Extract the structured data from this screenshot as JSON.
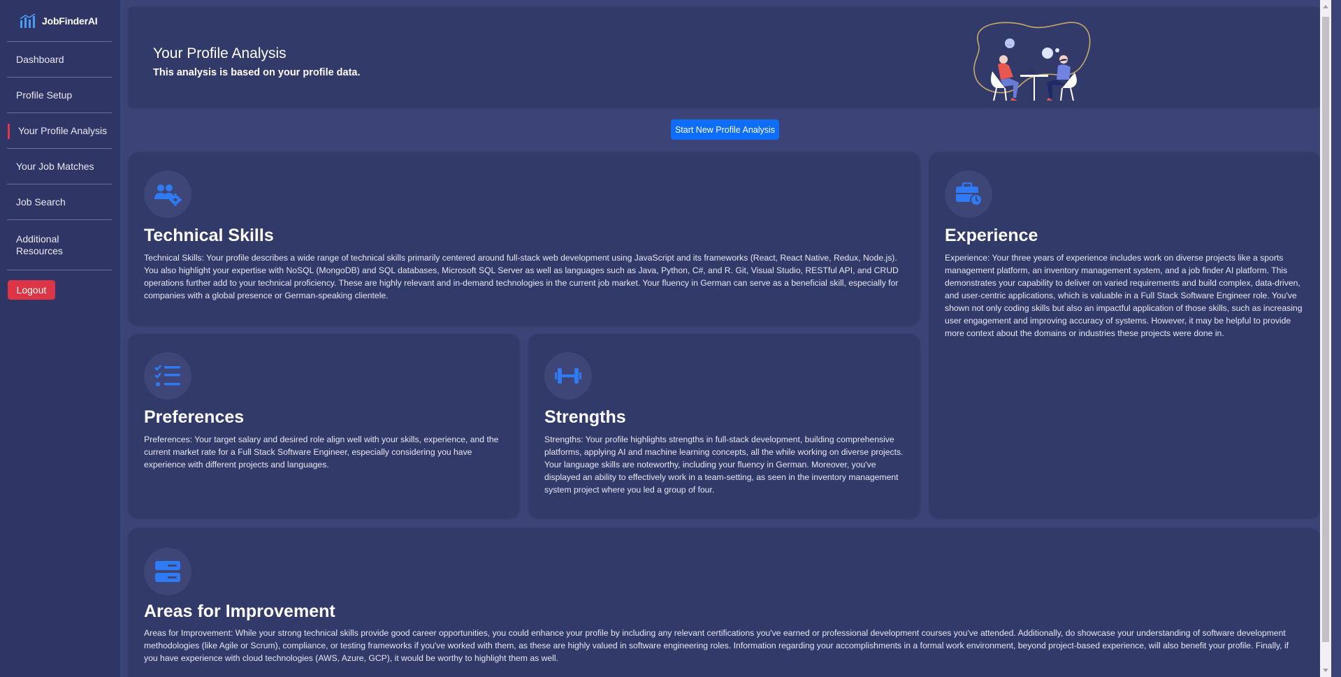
{
  "app": {
    "name": "JobFinderAI"
  },
  "sidebar": {
    "items": [
      {
        "label": "Dashboard",
        "active": false
      },
      {
        "label": "Profile Setup",
        "active": false
      },
      {
        "label": "Your Profile Analysis",
        "active": true
      },
      {
        "label": "Your Job Matches",
        "active": false
      },
      {
        "label": "Job Search",
        "active": false
      },
      {
        "label": "Additional Resources",
        "active": false
      }
    ],
    "logout_label": "Logout"
  },
  "header": {
    "title": "Your Profile Analysis",
    "subtitle": "This analysis is based on your profile data."
  },
  "actions": {
    "start_label": "Start New Profile Analysis"
  },
  "cards": {
    "technical": {
      "title": "Technical Skills",
      "icon": "users-gear-icon",
      "text": "Technical Skills: Your profile describes a wide range of technical skills primarily centered around full-stack web development using JavaScript and its frameworks (React, React Native, Redux, Node.js). You also highlight your expertise with NoSQL (MongoDB) and SQL databases, Microsoft SQL Server as well as languages such as Java, Python, C#, and R. Git, Visual Studio, RESTful API, and CRUD operations further add to your technical proficiency. These are highly relevant and in-demand technologies in the current job market. Your fluency in German can serve as a beneficial skill, especially for companies with a global presence or German-speaking clientele."
    },
    "experience": {
      "title": "Experience",
      "icon": "briefcase-clock-icon",
      "text": "Experience: Your three years of experience includes work on diverse projects like a sports management platform, an inventory management system, and a job finder AI platform. This demonstrates your capability to deliver on varied requirements and build complex, data-driven, and user-centric applications, which is valuable in a Full Stack Software Engineer role. You've shown not only coding skills but also an impactful application of those skills, such as increasing user engagement and improving accuracy of systems. However, it may be helpful to provide more context about the domains or industries these projects were done in."
    },
    "preferences": {
      "title": "Preferences",
      "icon": "list-check-icon",
      "text": "Preferences: Your target salary and desired role align well with your skills, experience, and the current market rate for a Full Stack Software Engineer, especially considering you have experience with different projects and languages."
    },
    "strengths": {
      "title": "Strengths",
      "icon": "dumbbell-icon",
      "text": "Strengths: Your profile highlights strengths in full-stack development, building comprehensive platforms, applying AI and machine learning concepts, all the while working on diverse projects. Your language skills are noteworthy, including your fluency in German. Moreover, you've displayed an ability to effectively work in a team-setting, as seen in the inventory management system project where you led a group of four."
    },
    "improvement": {
      "title": "Areas for Improvement",
      "icon": "server-icon",
      "text": "Areas for Improvement: While your strong technical skills provide good career opportunities, you could enhance your profile by including any relevant certifications you've earned or professional development courses you've attended. Additionally, do showcase your understanding of software development methodologies (like Agile or Scrum), compliance, or testing frameworks if you've worked with them, as these are highly valued in software engineering roles. Information regarding your accomplishments in a formal work environment, beyond project-based experience, will also benefit your profile. Finally, if you have experience with cloud technologies (AWS, Azure, GCP), it would be worthy to highlight them as well."
    }
  },
  "colors": {
    "background": "#3b4377",
    "sidebar": "#2f3665",
    "card": "#323a6a",
    "accent": "#0d6efd",
    "danger": "#dc3545",
    "icon": "#2f7bf5"
  }
}
